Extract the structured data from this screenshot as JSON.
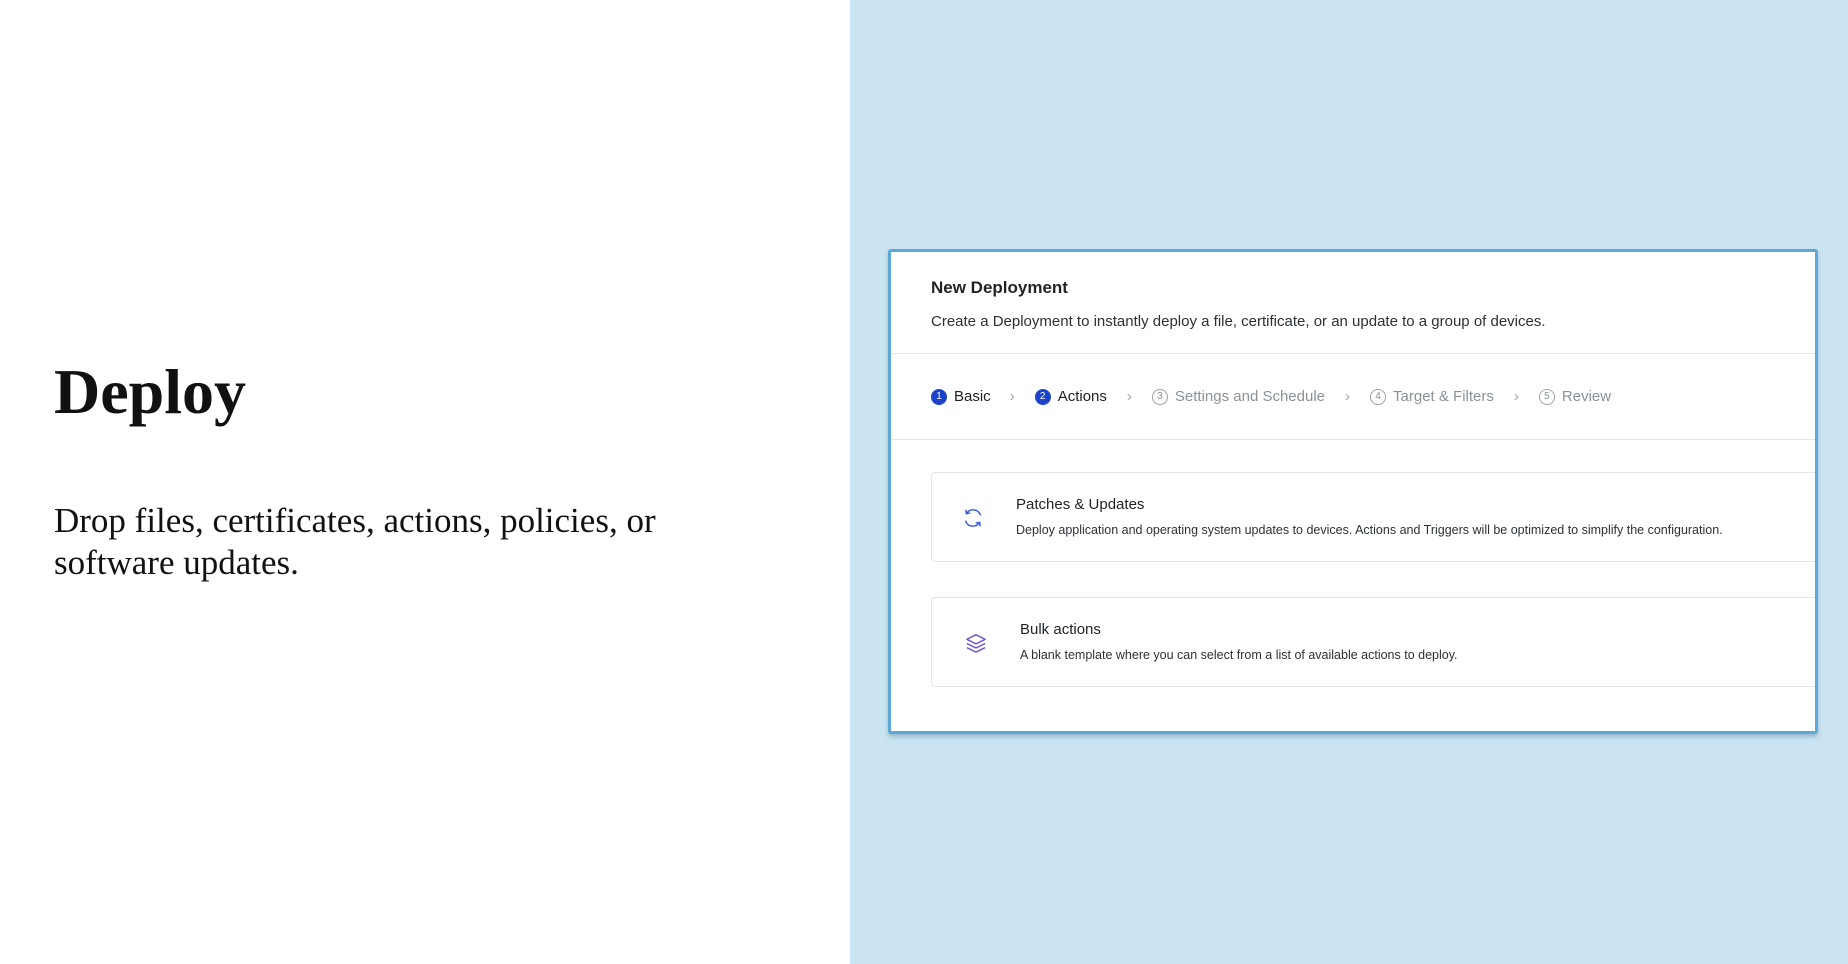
{
  "hero": {
    "title": "Deploy",
    "text": "Drop files, certificates, actions, policies, or software updates."
  },
  "panel": {
    "title": "New Deployment",
    "subtitle": "Create a Deployment to instantly deploy a file, certificate, or an update to a group of devices."
  },
  "steps": [
    {
      "num": "1",
      "label": "Basic",
      "state": "active"
    },
    {
      "num": "2",
      "label": "Actions",
      "state": "active"
    },
    {
      "num": "3",
      "label": "Settings and Schedule",
      "state": "inactive"
    },
    {
      "num": "4",
      "label": "Target & Filters",
      "state": "inactive"
    },
    {
      "num": "5",
      "label": "Review",
      "state": "inactive"
    }
  ],
  "cards": [
    {
      "icon": "refresh-icon",
      "title": "Patches & Updates",
      "description": "Deploy application and operating system updates to devices. Actions and Triggers will be optimized to simplify the configuration."
    },
    {
      "icon": "layers-icon",
      "title": "Bulk actions",
      "description": "A blank template where you can select from a list of available actions to deploy."
    }
  ],
  "colors": {
    "right_background": "#cae4f1",
    "panel_border": "#5fa8d5",
    "step_active": "#1d44c8",
    "step_inactive": "#8a9199",
    "refresh_icon": "#3b5bd6",
    "layers_icon": "#6a4fd0"
  }
}
